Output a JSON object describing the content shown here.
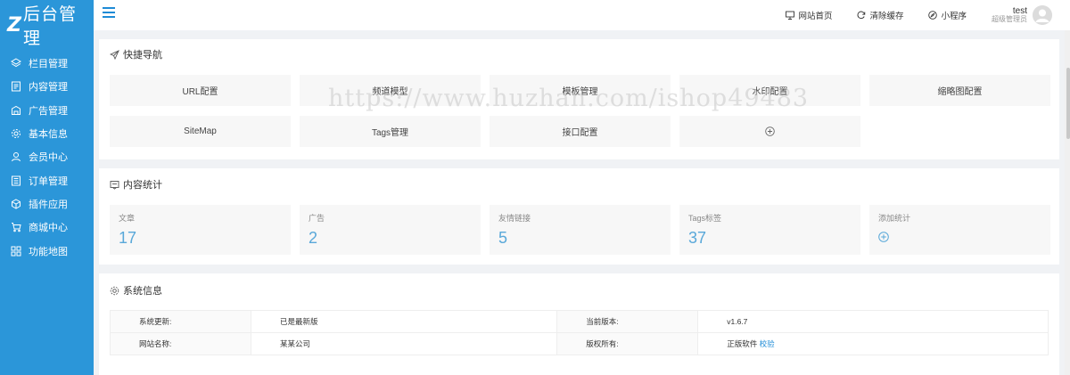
{
  "brand": {
    "logo_mark": "Z",
    "title": "后台管理"
  },
  "sidebar": {
    "items": [
      {
        "label": "栏目管理",
        "icon": "layers-icon"
      },
      {
        "label": "内容管理",
        "icon": "document-icon"
      },
      {
        "label": "广告管理",
        "icon": "ad-icon"
      },
      {
        "label": "基本信息",
        "icon": "gear-icon"
      },
      {
        "label": "会员中心",
        "icon": "user-icon"
      },
      {
        "label": "订单管理",
        "icon": "list-icon"
      },
      {
        "label": "插件应用",
        "icon": "cube-icon"
      },
      {
        "label": "商城中心",
        "icon": "cart-icon"
      },
      {
        "label": "功能地图",
        "icon": "grid-icon"
      }
    ]
  },
  "topbar": {
    "links": [
      {
        "label": "网站首页",
        "icon": "monitor-icon"
      },
      {
        "label": "清除缓存",
        "icon": "refresh-icon"
      },
      {
        "label": "小程序",
        "icon": "compass-icon"
      }
    ],
    "user": {
      "name": "test",
      "role": "超级管理员"
    }
  },
  "quick_nav": {
    "title": "快捷导航",
    "items": [
      "URL配置",
      "频道模型",
      "模板管理",
      "水印配置",
      "缩略图配置",
      "SiteMap",
      "Tags管理",
      "接口配置"
    ],
    "add_icon": "plus-circle-icon"
  },
  "stats": {
    "title": "内容统计",
    "items": [
      {
        "label": "文章",
        "value": "17"
      },
      {
        "label": "广告",
        "value": "2"
      },
      {
        "label": "友情链接",
        "value": "5"
      },
      {
        "label": "Tags标签",
        "value": "37"
      }
    ],
    "add_label": "添加统计"
  },
  "system": {
    "title": "系统信息",
    "rows": [
      {
        "k1": "系统更新:",
        "v1": "已是最新版",
        "k2": "当前版本:",
        "v2": "v1.6.7"
      },
      {
        "k1": "网站名称:",
        "v1": "某某公司",
        "k2": "版权所有:",
        "v2": "正版软件",
        "v2_link": "校验"
      }
    ]
  },
  "watermark": "https://www.huzhan.com/ishop49483",
  "colors": {
    "sidebar": "#2b96d9",
    "accent": "#1e8bd6",
    "stat_value": "#59a8d9"
  }
}
